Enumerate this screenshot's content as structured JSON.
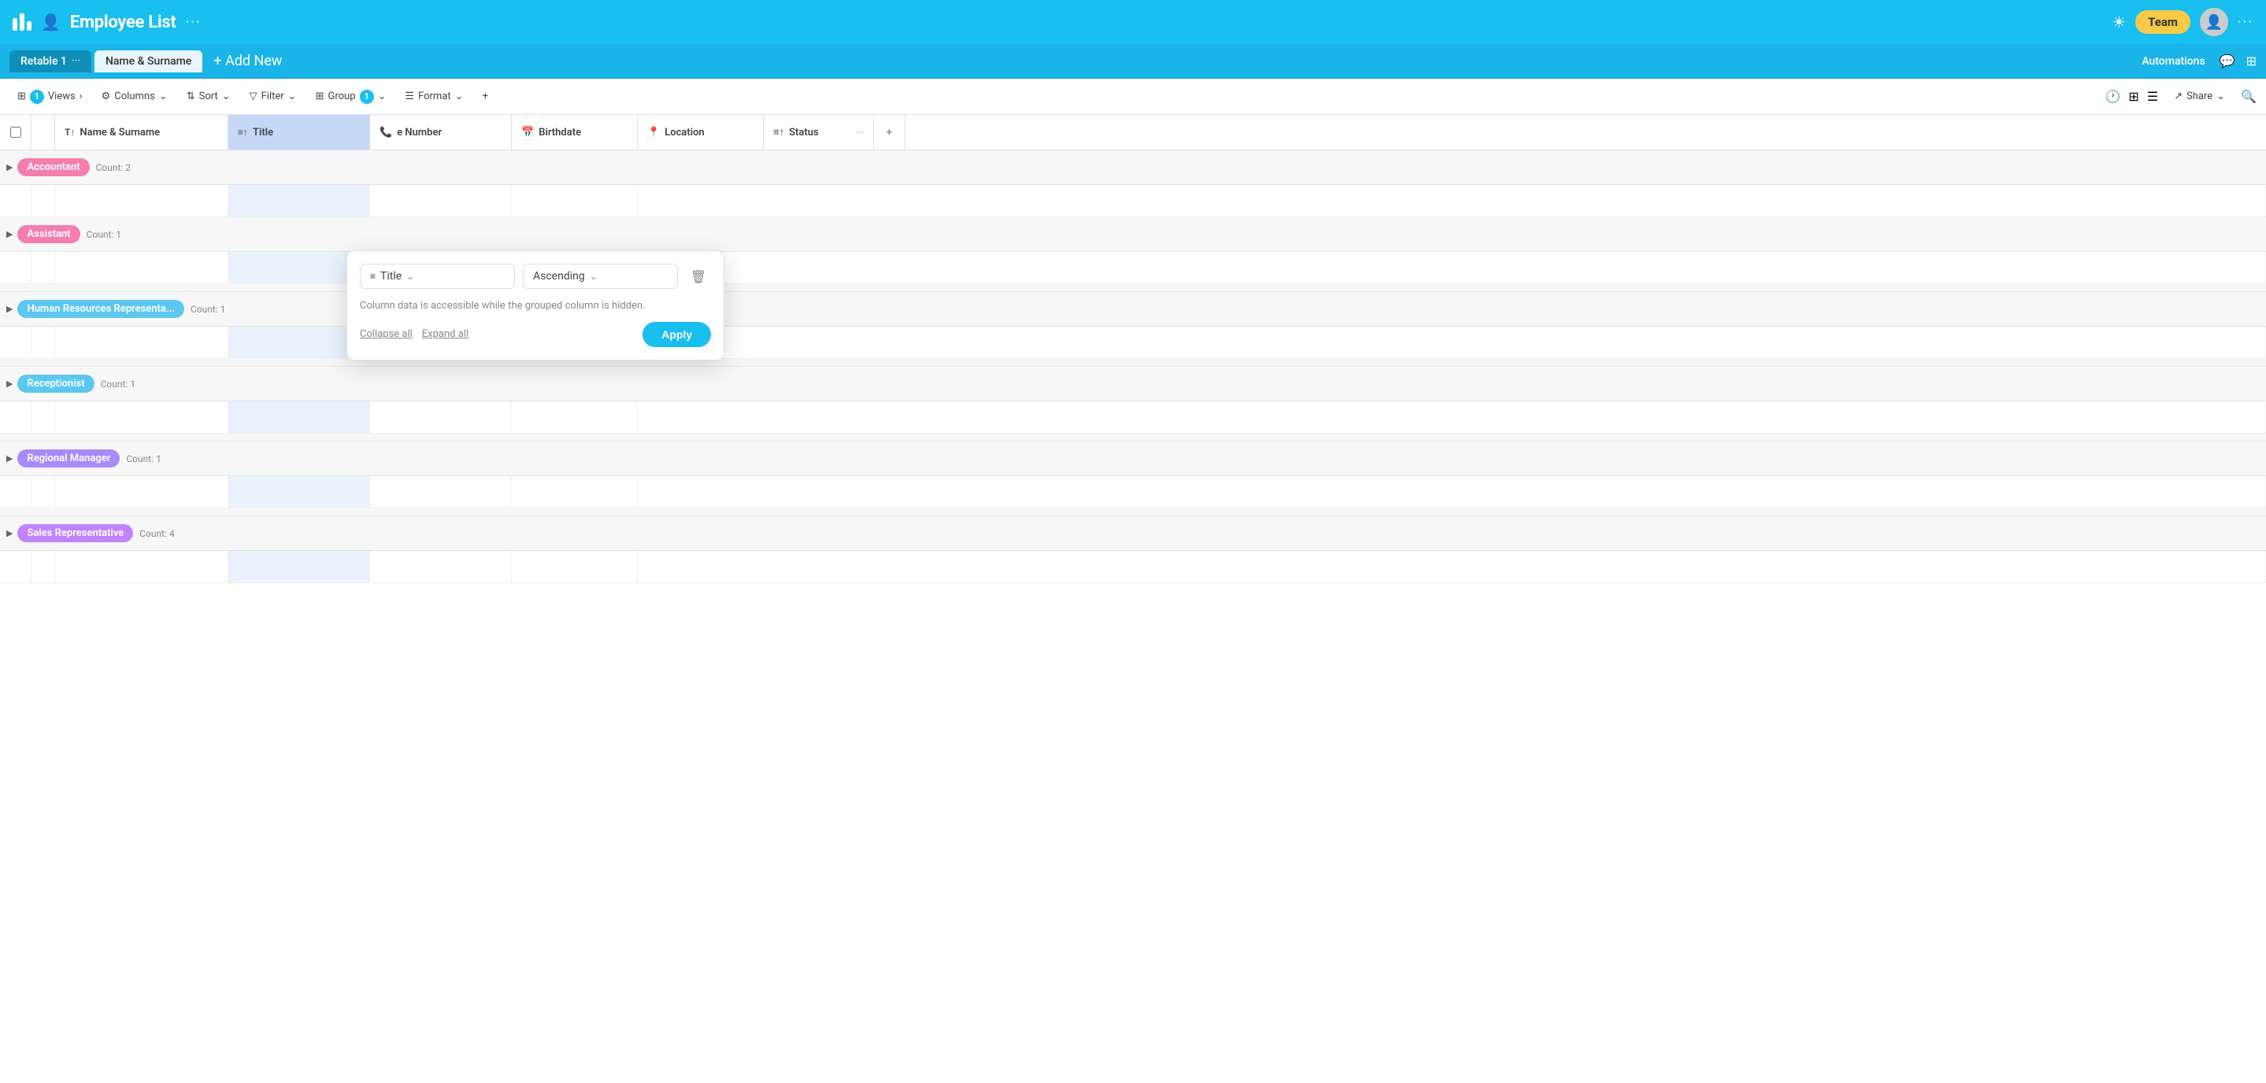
{
  "header": {
    "title": "Employee List",
    "dots_label": "···",
    "team_label": "Team",
    "sun_icon": "☀",
    "more_icon": "···"
  },
  "tabs": {
    "tab1_label": "Retable 1",
    "tab1_dots": "···",
    "tab2_label": "Name & Surname",
    "add_tab_label": "+ Add New",
    "automations_label": "Automations"
  },
  "toolbar": {
    "views_label": "Views",
    "views_count": "1",
    "columns_label": "Columns",
    "sort_label": "Sort",
    "filter_label": "Filter",
    "group_label": "Group",
    "group_count": "1",
    "format_label": "Format",
    "add_label": "+",
    "share_label": "Share",
    "search_icon": "🔍"
  },
  "columns": {
    "name_label": "Name & Surname",
    "title_label": "Title",
    "phone_label": "e Number",
    "birth_label": "Birthdate",
    "location_label": "Location",
    "status_label": "Status"
  },
  "group_popup": {
    "column_label": "Title",
    "order_label": "Ascending",
    "info_text": "Column data is accessible while the grouped\ncolumn is hidden.",
    "collapse_label": "Collapse all",
    "expand_label": "Expand all",
    "apply_label": "Apply",
    "delete_icon": "🗑"
  },
  "groups": [
    {
      "label": "Accountant",
      "count": "Count: 2",
      "color": "#f47eb0"
    },
    {
      "label": "Assistant",
      "count": "Count: 1",
      "color": "#f47eb0"
    },
    {
      "label": "Human Resources Representa...",
      "count": "Count: 1",
      "color": "#5bc8ef"
    },
    {
      "label": "Receptionist",
      "count": "Count: 1",
      "color": "#5bc8ef"
    },
    {
      "label": "Regional Manager",
      "count": "Count: 1",
      "color": "#a78bfa"
    },
    {
      "label": "Sales Representative",
      "count": "Count: 4",
      "color": "#c084fc"
    }
  ]
}
